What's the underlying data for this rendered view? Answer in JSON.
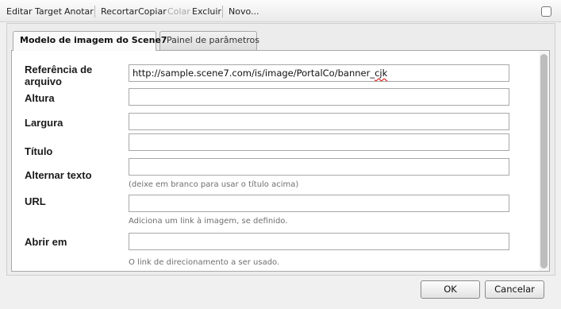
{
  "toolbar": {
    "editar": "Editar",
    "target": "Target",
    "anotar": "Anotar",
    "recortar": "Recortar",
    "copiar": "Copiar",
    "colar": "Colar",
    "excluir": "Excluir",
    "novo": "Novo..."
  },
  "tabs": [
    {
      "label": "Modelo de imagem do Scene7",
      "active": true
    },
    {
      "label": "Painel de parâmetros",
      "active": false
    }
  ],
  "form": {
    "file_ref": {
      "label": "Referência de arquivo",
      "value_prefix": "http://sample.scene7.com/is/image/PortalCo/banner_",
      "value_flagged": "cjk"
    },
    "height": {
      "label": "Altura",
      "value": ""
    },
    "width": {
      "label": "Largura",
      "value": ""
    },
    "title": {
      "label": "Título",
      "value": ""
    },
    "alt_text": {
      "label": "Alternar texto",
      "value": "",
      "hint": "(deixe em branco para usar o título acima)"
    },
    "url": {
      "label": "URL",
      "value": "",
      "hint": "Adiciona um link à imagem, se definido.",
      "icon": "search-icon"
    },
    "open_in": {
      "label": "Abrir em",
      "value": "",
      "hint": "O link de direcionamento a ser usado.",
      "icon": "chevron-down-icon"
    }
  },
  "buttons": {
    "ok": "OK",
    "cancel": "Cancelar"
  }
}
